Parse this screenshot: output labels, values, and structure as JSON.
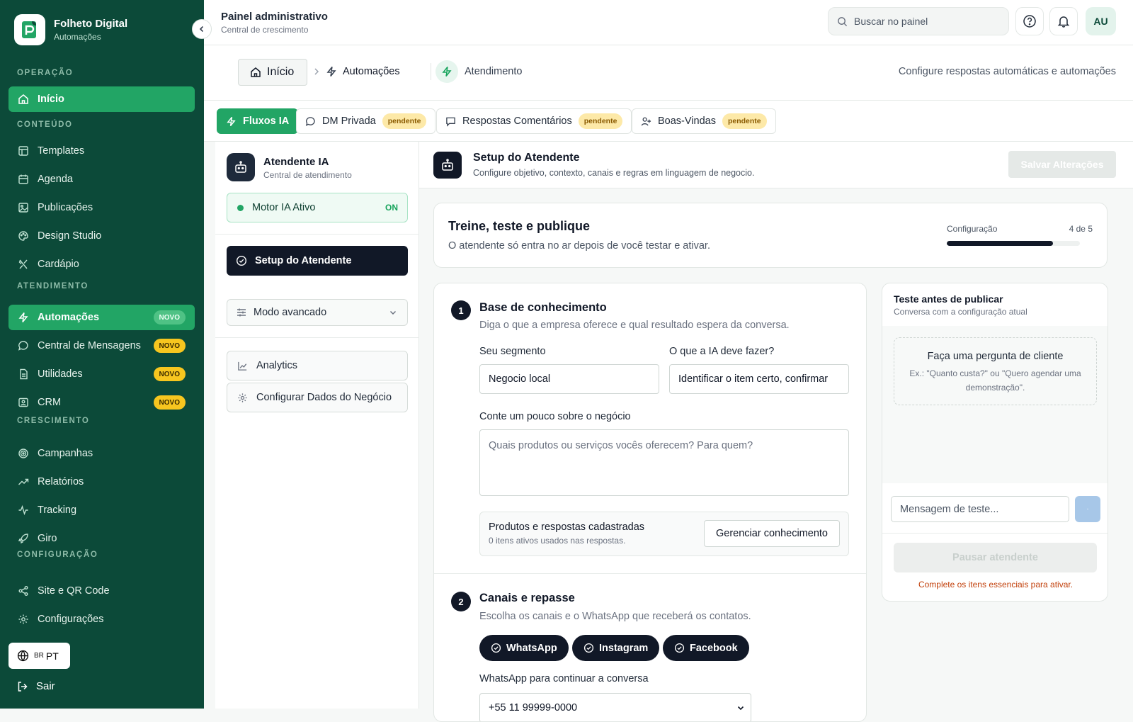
{
  "sidebar": {
    "brand": {
      "title": "Folheto Digital",
      "subtitle": "Automações"
    },
    "sections": {
      "operacao": "OPERAÇÃO",
      "conteudo": "CONTEÚDO",
      "atendimento": "ATENDIMENTO",
      "crescimento": "CRESCIMENTO",
      "configuracao": "CONFIGURAÇÃO"
    },
    "items": {
      "inicio": "Início",
      "templates": "Templates",
      "agenda": "Agenda",
      "publicacoes": "Publicações",
      "design_studio": "Design Studio",
      "cardapio": "Cardápio",
      "automacoes": "Automações",
      "central_mensagens": "Central de Mensagens",
      "utilidades": "Utilidades",
      "crm": "CRM",
      "campanhas": "Campanhas",
      "relatorios": "Relatórios",
      "tracking": "Tracking",
      "giro": "Giro",
      "site_qr": "Site e QR Code",
      "configuracoes": "Configurações"
    },
    "badge_novo": "NOVO",
    "lang": {
      "flag": "BR",
      "code": "PT"
    },
    "logout": "Sair",
    "active_color": "#22a565",
    "bg_color": "#0c4a39"
  },
  "topbar": {
    "title": "Painel administrativo",
    "subtitle": "Central de crescimento",
    "search_placeholder": "Buscar no painel",
    "avatar": "AU"
  },
  "breadcrumb": {
    "home": "Início",
    "automacoes": "Automações",
    "current": "Atendimento",
    "hint": "Configure respostas automáticas e automações"
  },
  "tabs": [
    {
      "label": "Fluxos IA",
      "active": true
    },
    {
      "label": "DM Privada",
      "badge": "pendente"
    },
    {
      "label": "Respostas Comentários",
      "badge": "pendente"
    },
    {
      "label": "Boas-Vindas",
      "badge": "pendente"
    }
  ],
  "left_panel": {
    "title": "Atendente IA",
    "subtitle": "Central de atendimento",
    "motor_label": "Motor IA Ativo",
    "motor_state": "ON",
    "setup": "Setup do Atendente",
    "mode": "Modo avancado",
    "analytics": "Analytics",
    "config_business": "Configurar Dados do Negócio"
  },
  "main": {
    "header": {
      "title": "Setup do Atendente",
      "subtitle": "Configure objetivo, contexto, canais e regras em linguagem de negocio.",
      "save": "Salvar Alterações"
    },
    "progress_card": {
      "title": "Treine, teste e publique",
      "subtitle": "O atendente só entra no ar depois de você testar e ativar.",
      "config_label": "Configuração",
      "step_text": "4 de 5",
      "progress": 0.8
    },
    "step1": {
      "num": "1",
      "title": "Base de conhecimento",
      "subtitle": "Diga o que a empresa oferece e qual resultado espera da conversa.",
      "segment_label": "Seu segmento",
      "segment_value": "Negocio local",
      "goal_label": "O que a IA deve fazer?",
      "goal_value": "Identificar o item certo, confirmar",
      "about_label": "Conte um pouco sobre o negócio",
      "about_placeholder": "Quais produtos ou serviços vocês oferecem? Para quem?",
      "kb_title": "Produtos e respostas cadastradas",
      "kb_sub": "0 itens ativos usados nas respostas.",
      "kb_button": "Gerenciar conhecimento"
    },
    "step2": {
      "num": "2",
      "title": "Canais e repasse",
      "subtitle": "Escolha os canais e o WhatsApp que receberá os contatos.",
      "channels": [
        "WhatsApp",
        "Instagram",
        "Facebook"
      ],
      "wa_label": "WhatsApp para continuar a conversa",
      "wa_value": "+55 11 99999-0000"
    },
    "test_card": {
      "title": "Teste antes de publicar",
      "subtitle": "Conversa com a configuração atual",
      "empty_title": "Faça uma pergunta de cliente",
      "empty_hint": "Ex.: \"Quanto custa?\" ou \"Quero agendar uma demonstração\".",
      "input_placeholder": "Mensagem de teste...",
      "pause": "Pausar atendente",
      "warning": "Complete os itens essenciais para ativar."
    }
  }
}
